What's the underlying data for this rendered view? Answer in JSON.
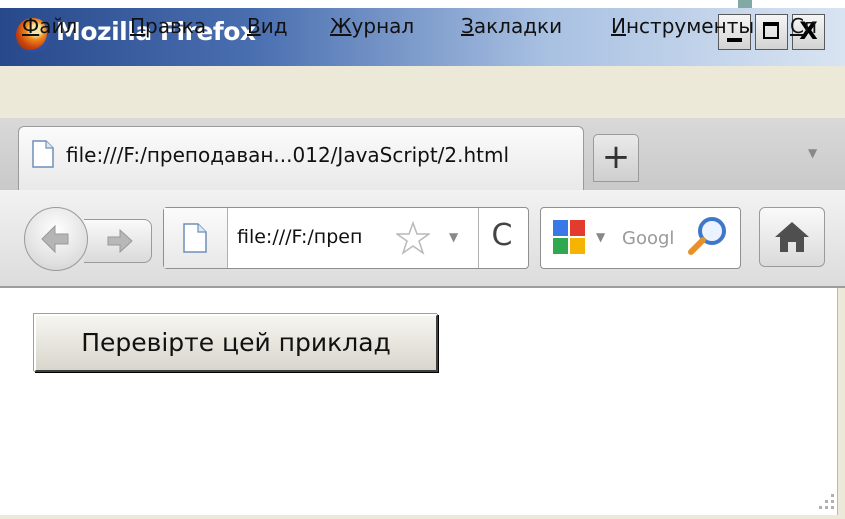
{
  "window": {
    "title": "Mozilla Firefox",
    "controls": [
      "minimize",
      "maximize",
      "close"
    ],
    "close_glyph": "X"
  },
  "menu": [
    {
      "label": "Файл"
    },
    {
      "label": "Правка"
    },
    {
      "label": "Вид"
    },
    {
      "label": "Журнал"
    },
    {
      "label": "Закладки"
    },
    {
      "label": "Инструменты"
    },
    {
      "label": "Сп"
    }
  ],
  "tabs": [
    {
      "title": "file:///F:/преподаван...012/JavaScript/2.html",
      "active": true
    }
  ],
  "new_tab_label": "+",
  "toolbar": {
    "url_text": "file:///F:/преп",
    "search_placeholder": "Googl",
    "reload_glyph": "C"
  },
  "icons": {
    "firefox_logo": "firefox-logo-icon",
    "page": "page-icon",
    "back": "back-arrow-icon",
    "forward": "forward-arrow-icon",
    "star": "bookmark-star-icon",
    "dropdown": "dropdown-arrow-icon",
    "reload": "reload-icon",
    "search_engine": "google-icon",
    "search": "magnifier-icon",
    "home": "home-icon",
    "resize": "resize-grip-icon"
  },
  "page": {
    "button_label": "Перевірте цей приклад"
  },
  "colors": {
    "titlebar_dark": "#27498c",
    "chrome_bg": "#ece9d8",
    "slide_accent": "#82a9a6"
  }
}
